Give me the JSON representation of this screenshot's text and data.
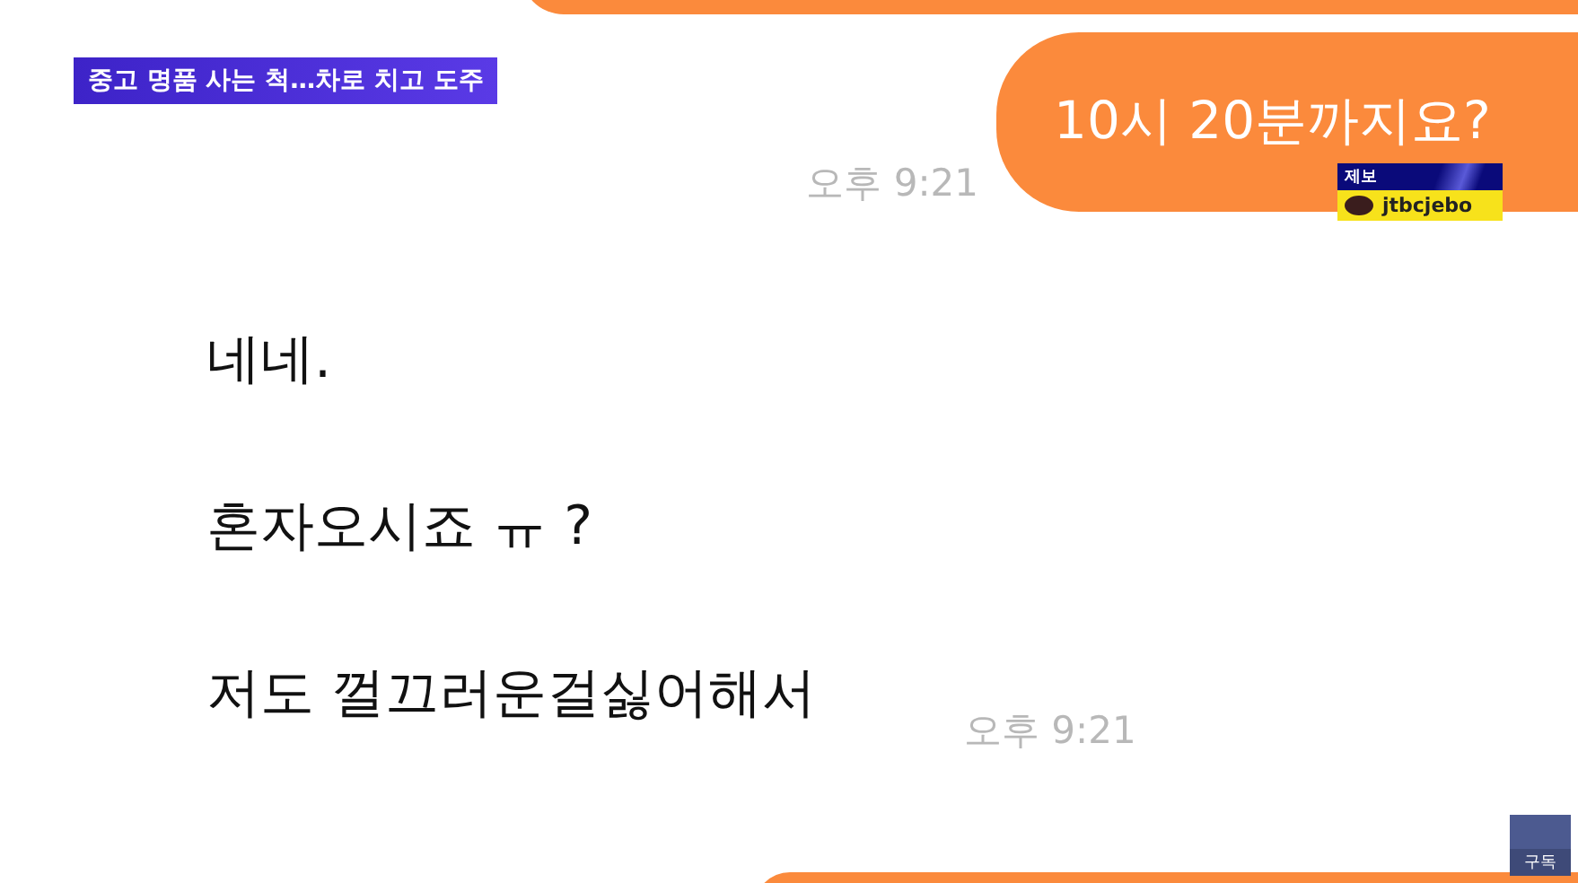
{
  "headline": "중고 명품 사는 척…차로 치고 도주",
  "messages": [
    {
      "kind": "outgoing",
      "text": "10시 20분까지요?",
      "time": "오후 9:21"
    },
    {
      "kind": "incoming",
      "lines": [
        "네네.",
        "혼자오시죠 ㅠ ?",
        "저도 껄끄러운걸싫어해서"
      ],
      "time": "오후 9:21"
    }
  ],
  "tip_box": {
    "label": "제보",
    "handle": "jtbcjebo"
  },
  "subscribe": {
    "label": "구독"
  }
}
